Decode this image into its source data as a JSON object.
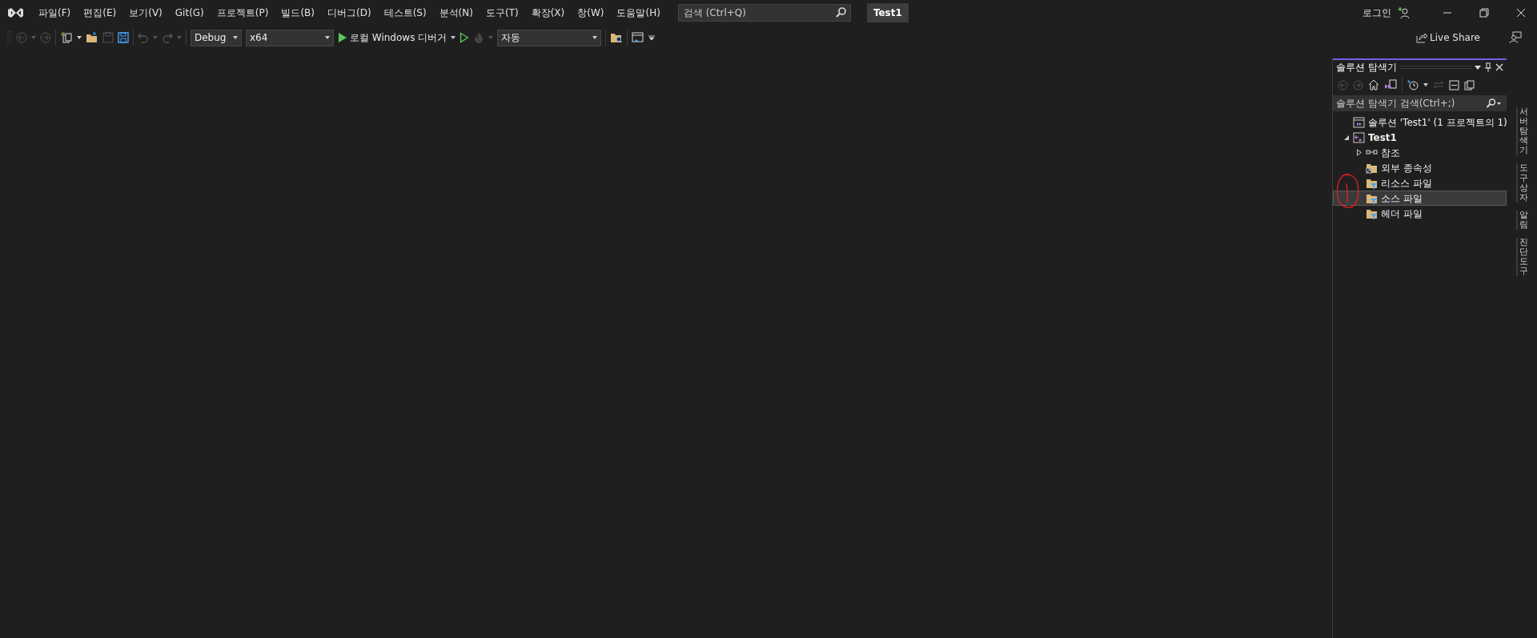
{
  "menu": [
    "파일(F)",
    "편집(E)",
    "보기(V)",
    "Git(G)",
    "프로젝트(P)",
    "빌드(B)",
    "디버그(D)",
    "테스트(S)",
    "분석(N)",
    "도구(T)",
    "확장(X)",
    "창(W)",
    "도움말(H)"
  ],
  "search": {
    "placeholder": "검색 (Ctrl+Q)"
  },
  "project_badge": "Test1",
  "login": "로그인",
  "toolbar": {
    "configuration": "Debug",
    "platform": "x64",
    "run_label": "로컬 Windows 디버거",
    "startup": "자동"
  },
  "live_share": "Live Share",
  "solution_explorer": {
    "title": "솔루션 탐색기",
    "search_placeholder": "솔루션 탐색기 검색(Ctrl+;)",
    "tree": [
      {
        "label": "솔루션 'Test1' (1 프로젝트의 1)",
        "kind": "solution",
        "selected": false,
        "children": [
          {
            "label": "Test1",
            "kind": "project",
            "selected": false,
            "expanded": true,
            "children": [
              {
                "label": "참조",
                "kind": "references",
                "selected": false,
                "expanded": false
              },
              {
                "label": "외부 종속성",
                "kind": "external",
                "selected": false
              },
              {
                "label": "리소스 파일",
                "kind": "filter",
                "selected": false
              },
              {
                "label": "소스 파일",
                "kind": "filter",
                "selected": true
              },
              {
                "label": "헤더 파일",
                "kind": "filter",
                "selected": false
              }
            ]
          }
        ]
      }
    ]
  },
  "side_tabs": [
    "서버 탐색기",
    "도구 상자",
    "알림",
    "진단 도구"
  ]
}
